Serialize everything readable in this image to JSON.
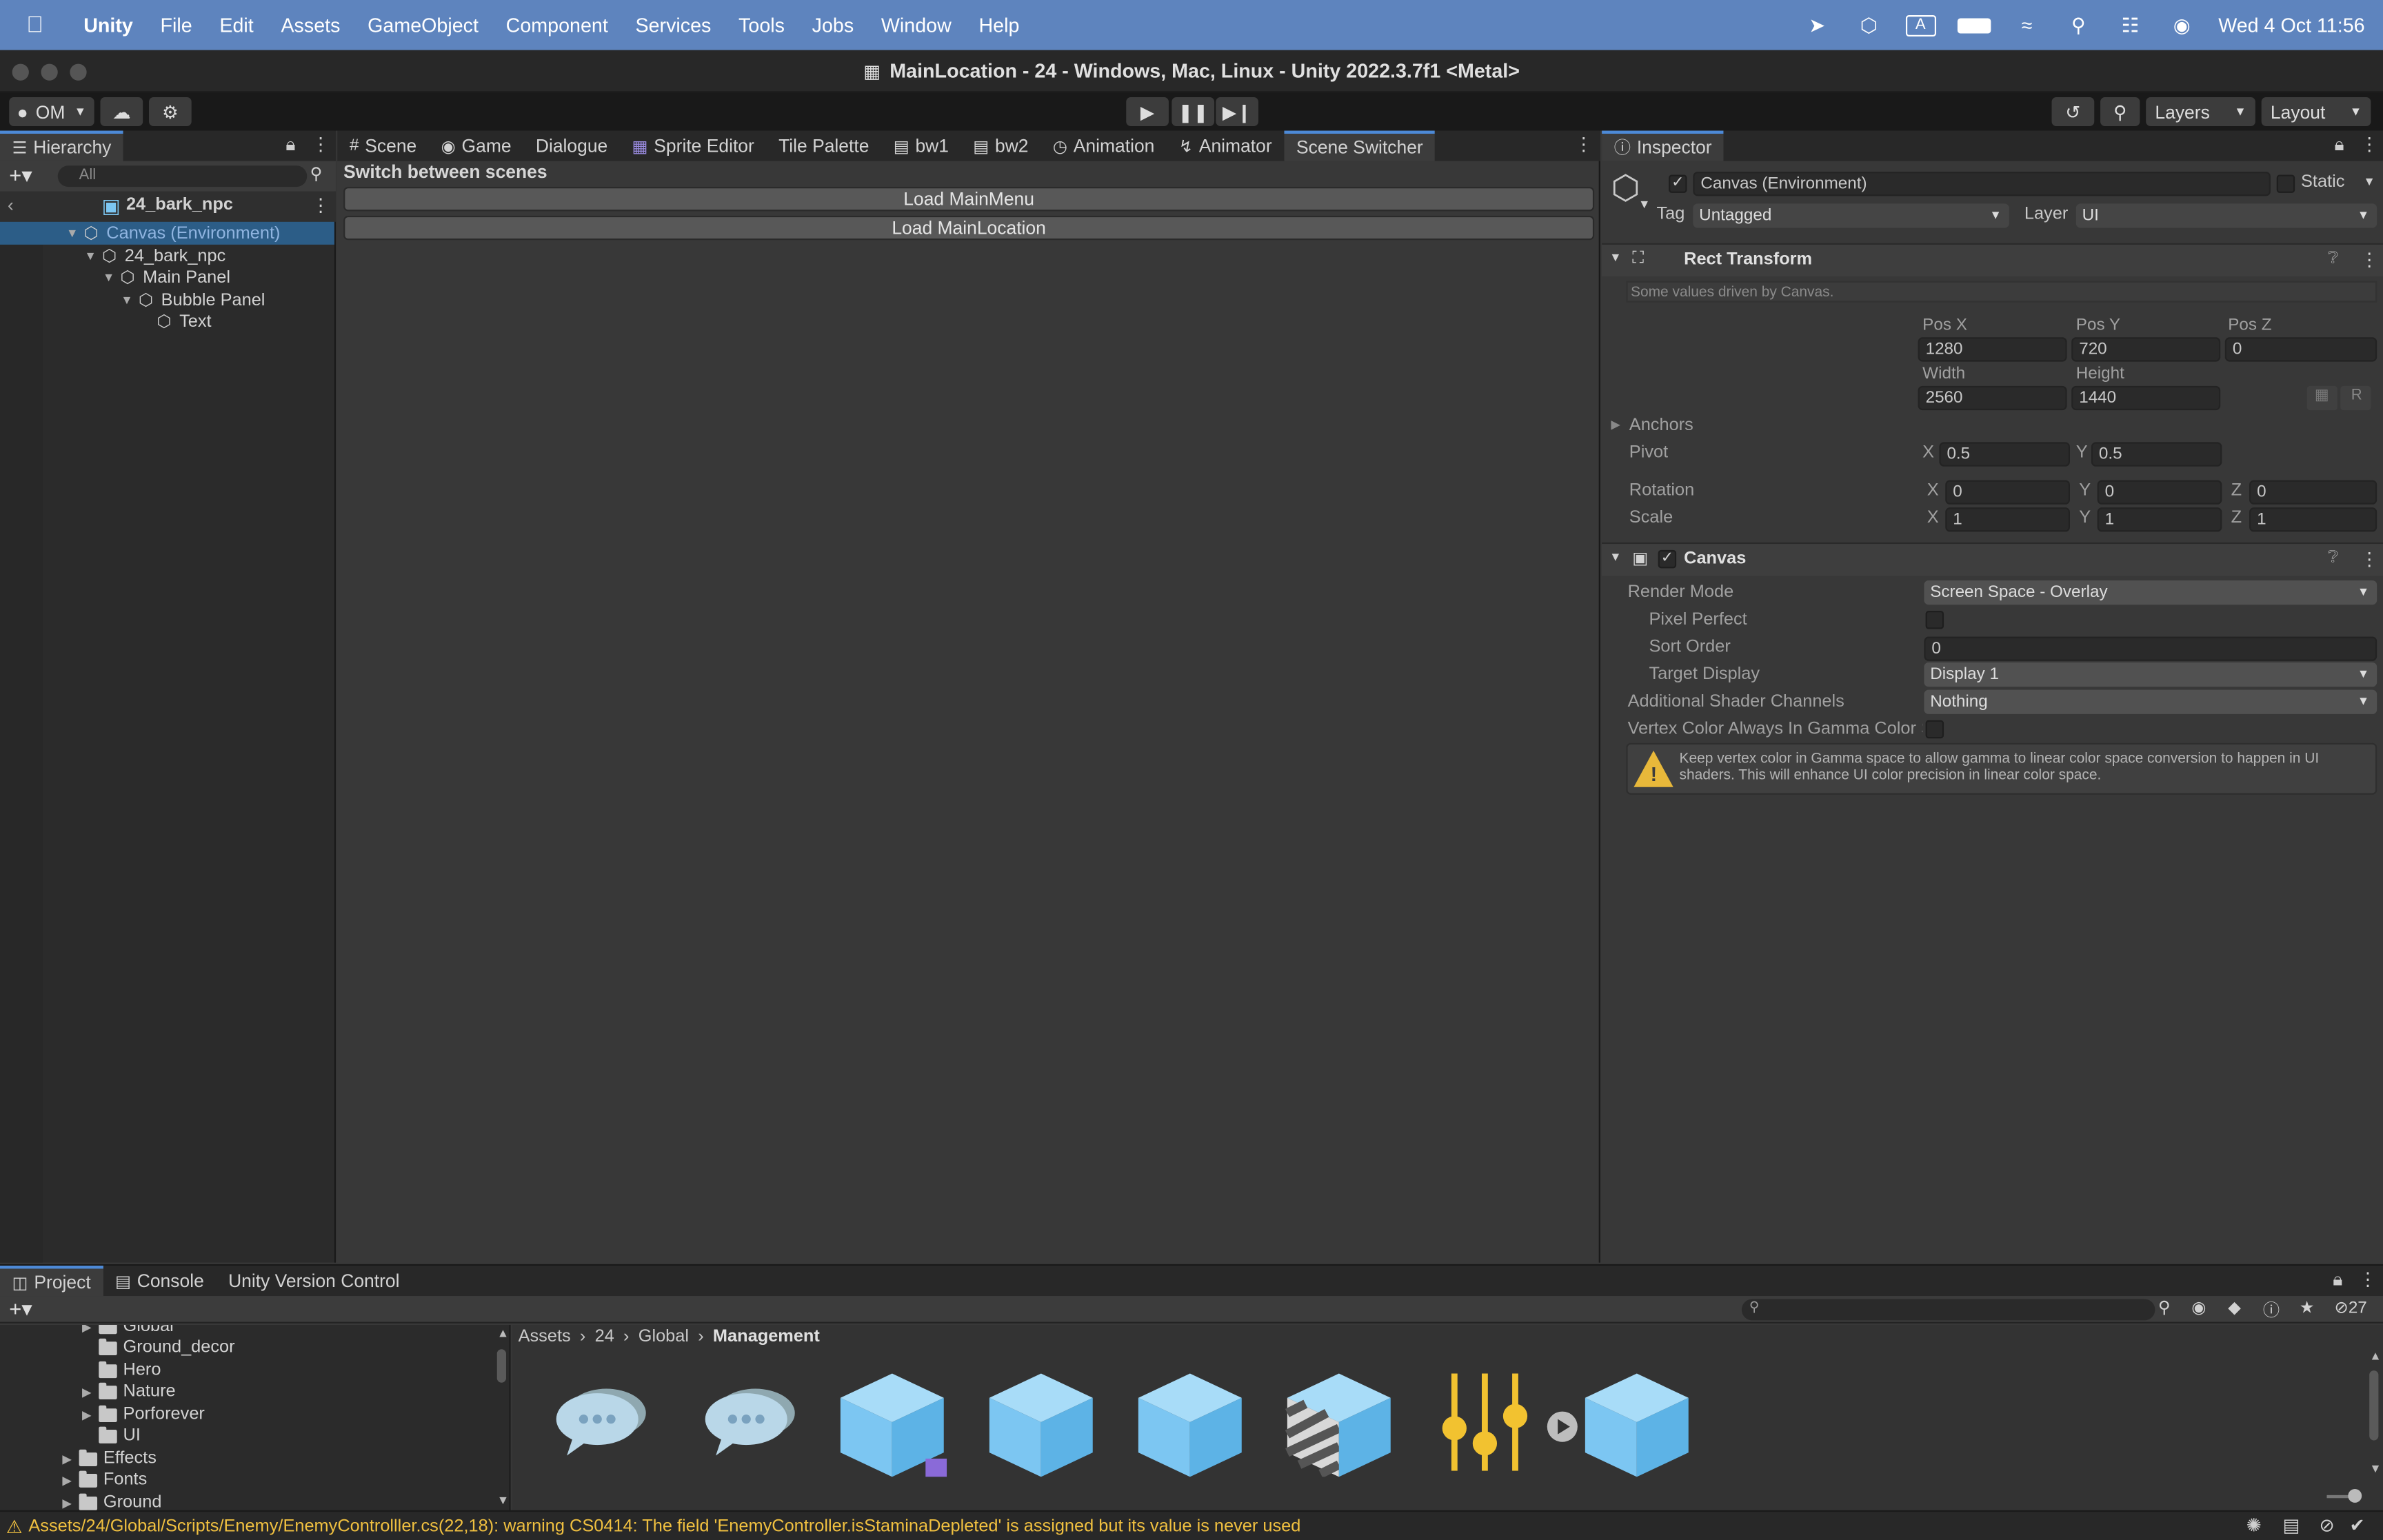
{
  "menubar": {
    "app": "Unity",
    "items": [
      "File",
      "Edit",
      "Assets",
      "GameObject",
      "Component",
      "Services",
      "Tools",
      "Jobs",
      "Window",
      "Help"
    ],
    "input_indicator": "A",
    "datetime": "Wed 4 Oct  11:56"
  },
  "window": {
    "title": "MainLocation - 24 - Windows, Mac, Linux - Unity 2022.3.7f1 <Metal>"
  },
  "toolbar": {
    "account": "OM",
    "layers": "Layers",
    "layout": "Layout"
  },
  "hierarchy": {
    "tab": "Hierarchy",
    "search_placeholder": "All",
    "scene_name": "24_bark_npc",
    "items": [
      {
        "label": "Canvas (Environment)"
      },
      {
        "label": "24_bark_npc"
      },
      {
        "label": "Main Panel"
      },
      {
        "label": "Bubble Panel"
      },
      {
        "label": "Text"
      }
    ]
  },
  "center_tabs": [
    "Scene",
    "Game",
    "Dialogue",
    "Sprite Editor",
    "Tile Palette",
    "bw1",
    "bw2",
    "Animation",
    "Animator",
    "Scene Switcher"
  ],
  "scene_switcher": {
    "heading": "Switch between scenes",
    "buttons": [
      "Load MainMenu",
      "Load MainLocation"
    ]
  },
  "inspector": {
    "tab": "Inspector",
    "object_name": "Canvas (Environment)",
    "static_label": "Static",
    "tag_label": "Tag",
    "tag_value": "Untagged",
    "layer_label": "Layer",
    "layer_value": "UI",
    "rect": {
      "title": "Rect Transform",
      "note": "Some values driven by Canvas.",
      "posx_label": "Pos X",
      "posy_label": "Pos Y",
      "posz_label": "Pos Z",
      "posx": "1280",
      "posy": "720",
      "posz": "0",
      "width_label": "Width",
      "height_label": "Height",
      "width": "2560",
      "height": "1440",
      "r_button": "R",
      "anchors": "Anchors",
      "pivot": "Pivot",
      "pivot_x": "0.5",
      "pivot_y": "0.5",
      "rotation": "Rotation",
      "rot_x": "0",
      "rot_y": "0",
      "rot_z": "0",
      "scale": "Scale",
      "scale_x": "1",
      "scale_y": "1",
      "scale_z": "1",
      "axis_x": "X",
      "axis_y": "Y",
      "axis_z": "Z"
    },
    "canvas": {
      "title": "Canvas",
      "render_mode_label": "Render Mode",
      "render_mode": "Screen Space - Overlay",
      "pixel_perfect_label": "Pixel Perfect",
      "sort_order_label": "Sort Order",
      "sort_order": "0",
      "target_display_label": "Target Display",
      "target_display": "Display 1",
      "shader_channels_label": "Additional Shader Channels",
      "shader_channels": "Nothing",
      "vertex_color_label": "Vertex Color Always In Gamma Color S",
      "warning": "Keep vertex color in Gamma space to allow gamma to linear color space conversion to happen in UI shaders. This will enhance UI color precision in linear color space."
    }
  },
  "project": {
    "tabs": [
      "Project",
      "Console",
      "Unity Version Control"
    ],
    "hidden_count": "27",
    "tree": [
      {
        "label": "Global",
        "indent": 3,
        "arrow": true
      },
      {
        "label": "Ground_decor",
        "indent": 3,
        "arrow": false
      },
      {
        "label": "Hero",
        "indent": 3,
        "arrow": false
      },
      {
        "label": "Nature",
        "indent": 3,
        "arrow": true
      },
      {
        "label": "Porforever",
        "indent": 3,
        "arrow": true
      },
      {
        "label": "UI",
        "indent": 3,
        "arrow": false
      },
      {
        "label": "Effects",
        "indent": 2,
        "arrow": true
      },
      {
        "label": "Fonts",
        "indent": 2,
        "arrow": true
      },
      {
        "label": "Ground",
        "indent": 2,
        "arrow": true
      }
    ],
    "breadcrumb": [
      "Assets",
      "24",
      "Global",
      "Management"
    ]
  },
  "status": {
    "message": "Assets/24/Global/Scripts/Enemy/EnemyControlller.cs(22,18): warning CS0414: The field 'EnemyController.isStaminaDepleted' is assigned but its value is never used"
  },
  "colors": {
    "accent": "#4d8ad7",
    "selection": "#2c5d87",
    "warning": "#f0c040",
    "asset_blue": "#7cc6f2"
  }
}
